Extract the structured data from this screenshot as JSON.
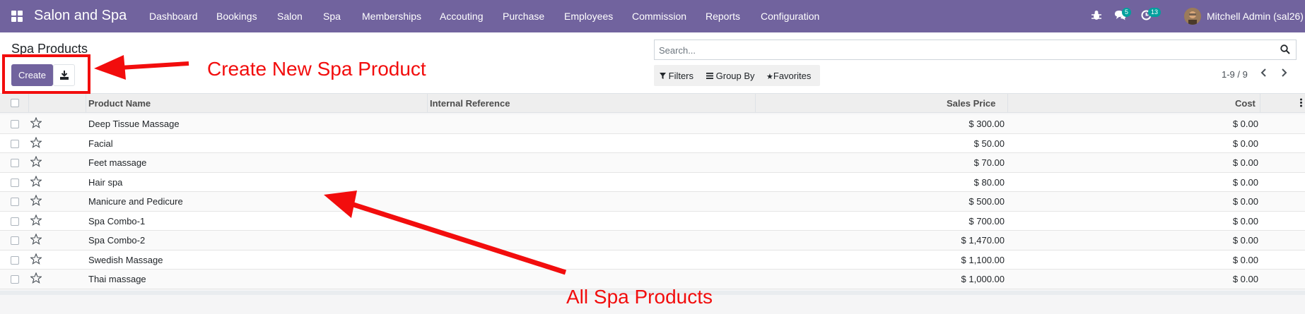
{
  "topbar": {
    "app_title": "Salon and Spa",
    "menu": [
      "Dashboard",
      "Bookings",
      "Salon",
      "Spa",
      "Memberships",
      "Accouting",
      "Purchase",
      "Employees",
      "Commission",
      "Reports",
      "Configuration"
    ],
    "messages_count": "5",
    "activities_count": "13",
    "user_name": "Mitchell Admin (sal26)"
  },
  "control_panel": {
    "title": "Spa Products",
    "create_label": "Create",
    "search_placeholder": "Search...",
    "filters_label": "Filters",
    "group_by_label": "Group By",
    "favorites_label": "Favorites",
    "pager": "1-9 / 9"
  },
  "list": {
    "columns": {
      "product_name": "Product Name",
      "internal_reference": "Internal Reference",
      "sales_price": "Sales Price",
      "cost": "Cost"
    },
    "rows": [
      {
        "name": "Deep Tissue Massage",
        "ref": "",
        "price": "$ 300.00",
        "cost": "$ 0.00"
      },
      {
        "name": "Facial",
        "ref": "",
        "price": "$ 50.00",
        "cost": "$ 0.00"
      },
      {
        "name": "Feet massage",
        "ref": "",
        "price": "$ 70.00",
        "cost": "$ 0.00"
      },
      {
        "name": "Hair spa",
        "ref": "",
        "price": "$ 80.00",
        "cost": "$ 0.00"
      },
      {
        "name": "Manicure and Pedicure",
        "ref": "",
        "price": "$ 500.00",
        "cost": "$ 0.00"
      },
      {
        "name": "Spa Combo-1",
        "ref": "",
        "price": "$ 700.00",
        "cost": "$ 0.00"
      },
      {
        "name": "Spa Combo-2",
        "ref": "",
        "price": "$ 1,470.00",
        "cost": "$ 0.00"
      },
      {
        "name": "Swedish Massage",
        "ref": "",
        "price": "$ 1,100.00",
        "cost": "$ 0.00"
      },
      {
        "name": "Thai massage",
        "ref": "",
        "price": "$ 1,000.00",
        "cost": "$ 0.00"
      }
    ]
  },
  "annotations": {
    "create_note": "Create New Spa Product",
    "list_note": "All Spa Products"
  },
  "colors": {
    "brand": "#71639e",
    "annotation": "#f20d0d",
    "badge": "#00a09d"
  }
}
